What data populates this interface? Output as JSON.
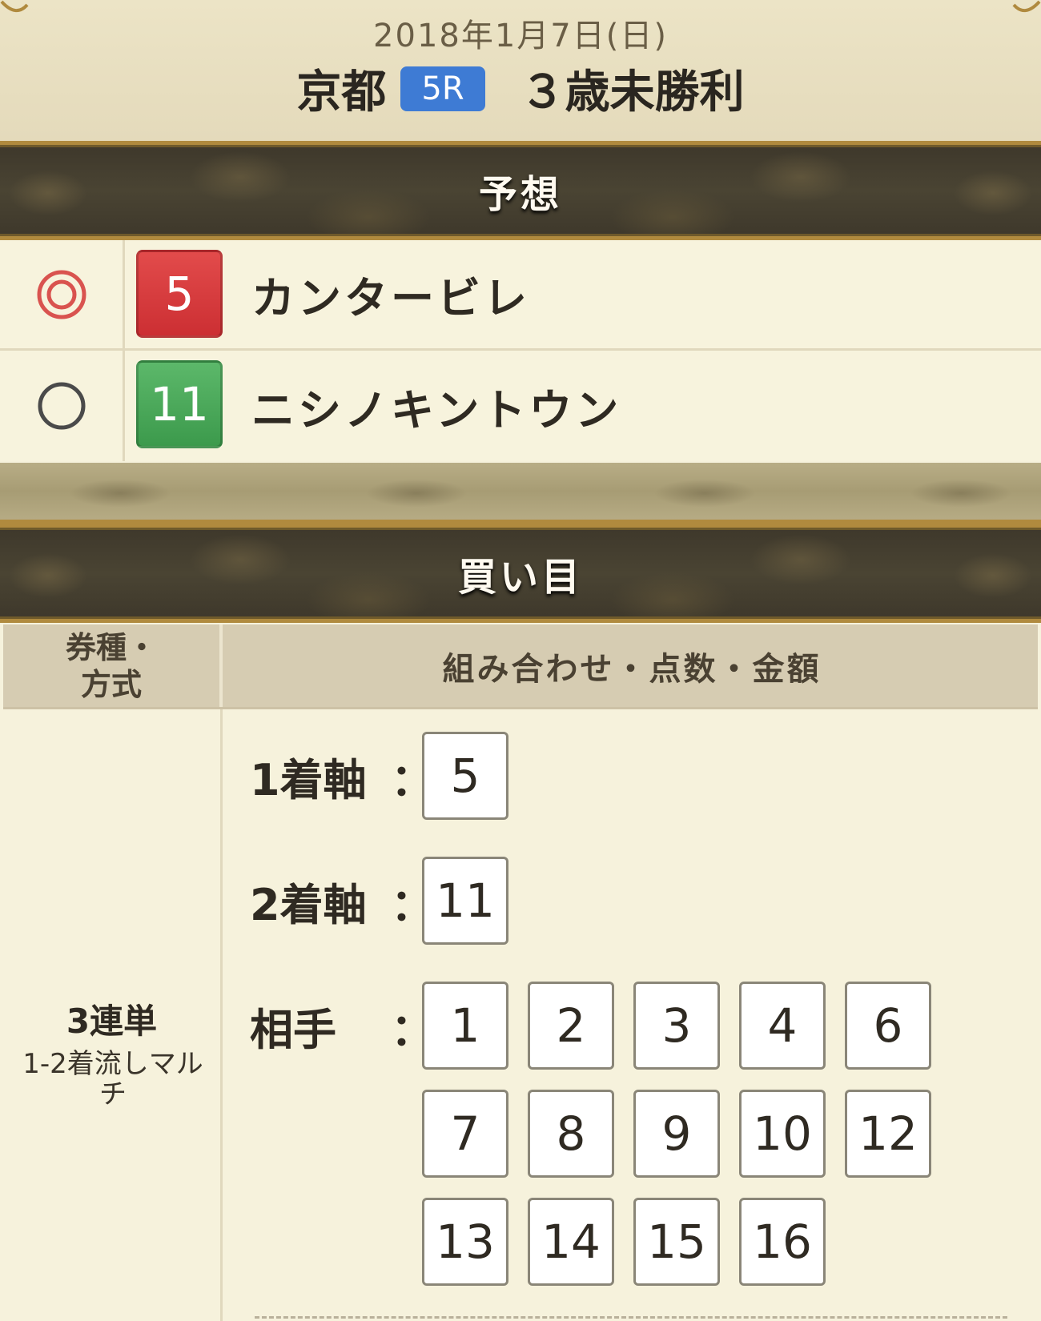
{
  "header": {
    "date": "2018年1月7日(日)",
    "venue": "京都",
    "race_number": "5R",
    "race_name": "３歳未勝利"
  },
  "prediction": {
    "title": "予想",
    "entries": [
      {
        "mark": "◎",
        "number": "5",
        "name": "カンタービレ",
        "color": "#d63a3d"
      },
      {
        "mark": "○",
        "number": "11",
        "name": "ニシノキントウン",
        "color": "#48a557"
      }
    ]
  },
  "bets": {
    "title": "買い目",
    "col_type_header": "券種・\n方式",
    "col_combo_header": "組み合わせ・点数・金額",
    "bet_type": "3連単",
    "bet_method": "1-2着流しマルチ",
    "first_label": "1着軸",
    "first_numbers": [
      "5"
    ],
    "second_label": "2着軸",
    "second_numbers": [
      "11"
    ],
    "partner_label": "相手",
    "colon": "：",
    "partner_numbers": [
      "1",
      "2",
      "3",
      "4",
      "6",
      "7",
      "8",
      "9",
      "10",
      "12",
      "13",
      "14",
      "15",
      "16"
    ]
  },
  "colors": {
    "badge_blue": "#3e7bd4",
    "gold_border": "#b08a3e",
    "background": "#f6f2dc"
  }
}
